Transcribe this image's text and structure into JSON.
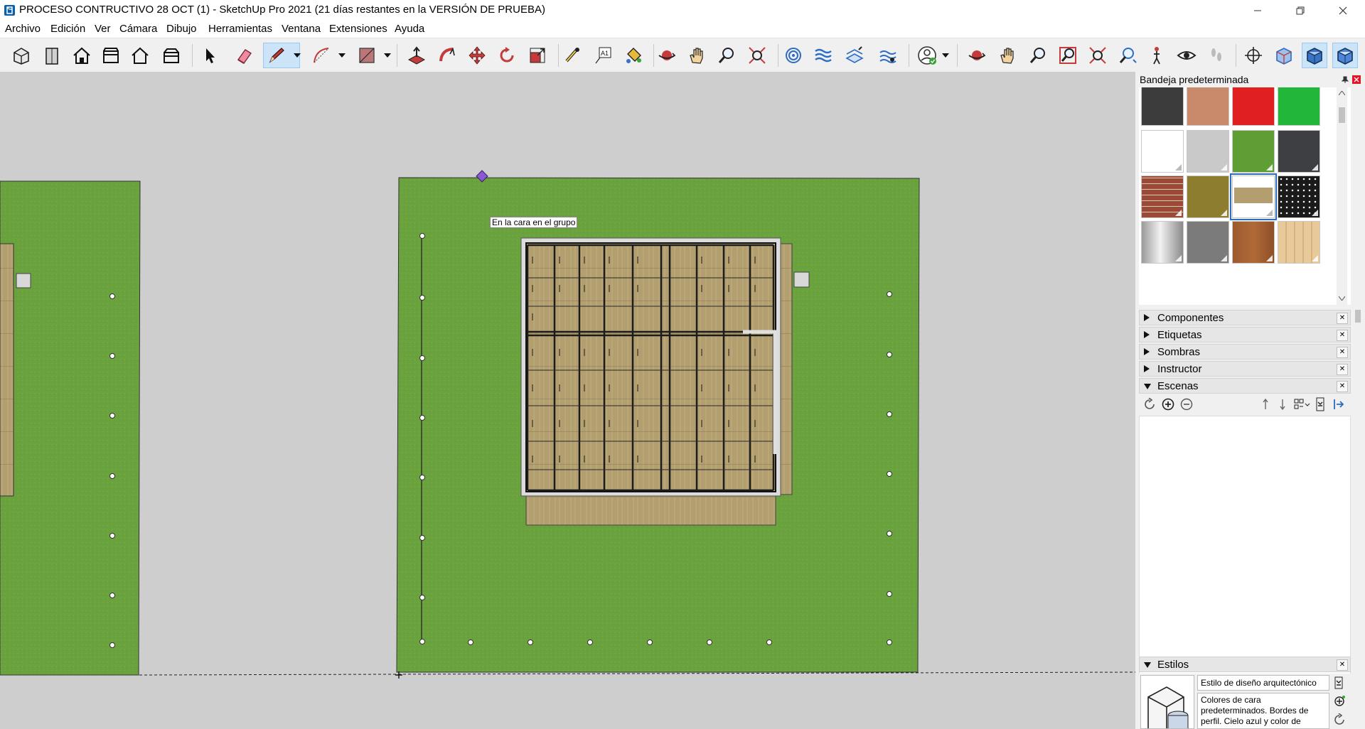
{
  "window": {
    "title": "PROCESO CONTRUCTIVO 28 OCT (1) - SketchUp Pro 2021 (21 días restantes en la VERSIÓN DE PRUEBA)"
  },
  "menu": [
    "Archivo",
    "Edición",
    "Ver",
    "Cámara",
    "Dibujo",
    "Herramientas",
    "Ventana",
    "Extensiones",
    "Ayuda"
  ],
  "toolbar": {
    "active_tool": "pencil-tool"
  },
  "viewport": {
    "inference_tooltip": "En la cara en el grupo",
    "colors": {
      "background": "#cecece",
      "grass": "#6aa33d",
      "wood": "#b29e6e",
      "beams": "#1c1c1c"
    }
  },
  "tray": {
    "title": "Bandeja predeterminada",
    "panels": [
      {
        "label": "Componentes",
        "expanded": false
      },
      {
        "label": "Etiquetas",
        "expanded": false
      },
      {
        "label": "Sombras",
        "expanded": false
      },
      {
        "label": "Instructor",
        "expanded": false
      },
      {
        "label": "Escenas",
        "expanded": true
      }
    ],
    "styles": {
      "label": "Estilos",
      "style_name": "Estilo de diseño arquitectónico",
      "description": "Colores de cara predeterminados. Bordes de perfil. Cielo azul y color de"
    }
  }
}
